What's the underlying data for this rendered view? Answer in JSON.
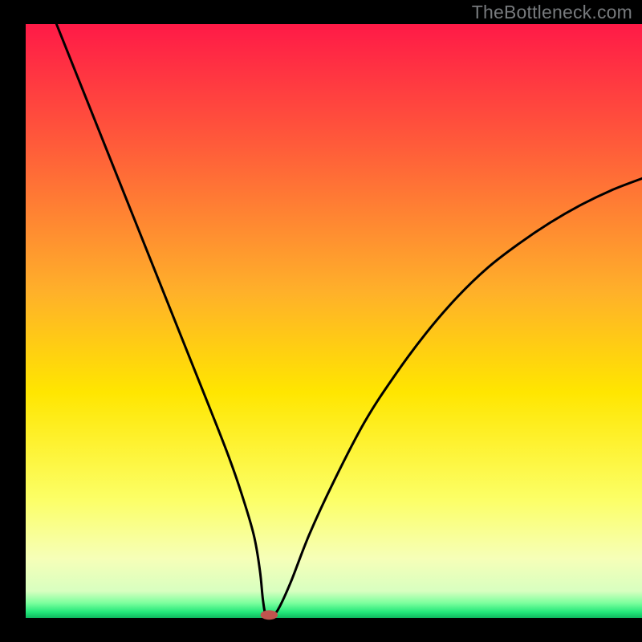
{
  "watermark": "TheBottleneck.com",
  "chart_data": {
    "type": "line",
    "title": "",
    "xlabel": "",
    "ylabel": "",
    "xlim": [
      0,
      100
    ],
    "ylim": [
      0,
      100
    ],
    "grid": false,
    "legend": false,
    "background_gradient_stops": [
      {
        "offset": 0.0,
        "color": "#ff1a47"
      },
      {
        "offset": 0.2,
        "color": "#ff5a3a"
      },
      {
        "offset": 0.45,
        "color": "#ffb02a"
      },
      {
        "offset": 0.62,
        "color": "#ffe600"
      },
      {
        "offset": 0.8,
        "color": "#fcff66"
      },
      {
        "offset": 0.9,
        "color": "#f6ffb8"
      },
      {
        "offset": 0.955,
        "color": "#d8ffc0"
      },
      {
        "offset": 0.975,
        "color": "#7bff9d"
      },
      {
        "offset": 0.99,
        "color": "#23e87a"
      },
      {
        "offset": 1.0,
        "color": "#0fb85f"
      }
    ],
    "series": [
      {
        "name": "bottleneck-curve",
        "x": [
          5,
          10,
          15,
          20,
          25,
          30,
          33,
          35,
          37,
          38,
          38.5,
          39,
          40,
          41,
          43,
          46,
          50,
          55,
          60,
          65,
          70,
          75,
          80,
          85,
          90,
          95,
          100
        ],
        "y": [
          100,
          87,
          74,
          61,
          48,
          35,
          27,
          21,
          14,
          8,
          3,
          0.5,
          0.5,
          1.5,
          6,
          14,
          23,
          33,
          41,
          48,
          54,
          59,
          63,
          66.5,
          69.5,
          72,
          74
        ]
      }
    ],
    "marker": {
      "x": 39.5,
      "y": 0.5,
      "rx": 1.4,
      "ry": 0.8,
      "color": "#c0544e"
    },
    "frame": {
      "left_tick_y": 100,
      "bottom_line_y": 0
    }
  }
}
